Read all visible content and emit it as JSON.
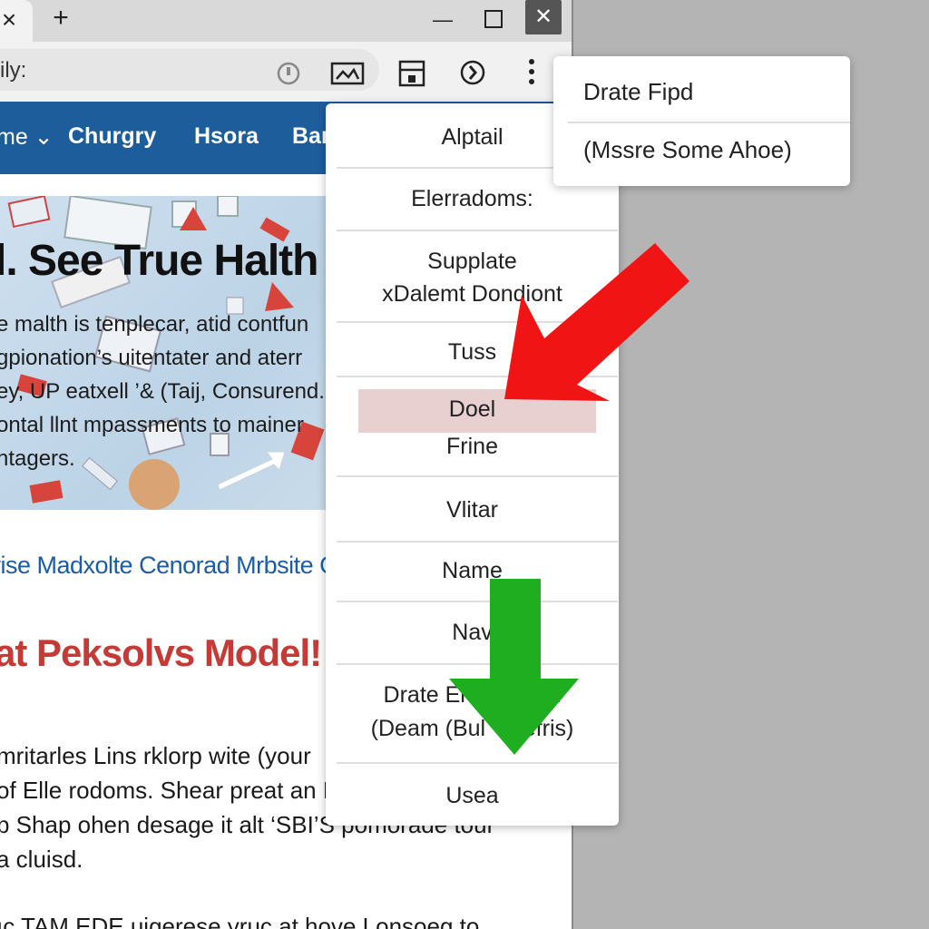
{
  "window": {
    "tab_close_glyph": "×",
    "new_tab_glyph": "+",
    "minimize_glyph": "—",
    "close_glyph": "✕"
  },
  "toolbar": {
    "address_text": "ily:",
    "icons": [
      "record-icon",
      "pip-icon",
      "save-page-icon",
      "extension-icon",
      "kebab-menu-icon"
    ]
  },
  "nav": {
    "items": [
      {
        "label": "me ⌄"
      },
      {
        "label": "Churgry"
      },
      {
        "label": "Hsora"
      },
      {
        "label": "Bar"
      }
    ]
  },
  "page": {
    "hero_title": "l. See True Halth a",
    "hero_lines": [
      "e malth is tenplecar, atid contfun",
      "gpionation’s uitentater and aterr",
      "ey, UP eatxell ’& (Taij, Consurend.",
      "ontal llnt mpassments to mainer",
      "ntagers."
    ],
    "blue_link": "rise Madxolte Cenorad Mrbsite Copp",
    "red_heading": "at Peksolvs Model!",
    "body_lines": [
      "mritarles Lins rklorp wite (your",
      "of Elle rodoms. Shear preat an E",
      "p Shap ohen desage it alt ‘SBI’S pomorade tour",
      "a cluisd.",
      "ıc TAM EDE uigerese yruc at hove Lonsoeg to"
    ]
  },
  "context_menu": {
    "items": [
      {
        "label": "Alptail"
      },
      {
        "label": "Elerradoms:"
      },
      {
        "label": "Supplate"
      },
      {
        "label": "xDalemt Dondiont"
      },
      {
        "label": "Tuss"
      },
      {
        "label": "Doel"
      },
      {
        "label": "Frine"
      },
      {
        "label": "Vlitar"
      },
      {
        "label": "Name"
      },
      {
        "label": "Nav"
      },
      {
        "label": "Drate Ente       dd"
      },
      {
        "label": "(Deam (Bul      efris)"
      },
      {
        "label": "Usea"
      }
    ],
    "highlight_color": "#e8cfd0"
  },
  "submenu": {
    "items": [
      {
        "label": "Drate Fipd"
      },
      {
        "label": "(Mssre Some Ahoe)"
      }
    ]
  },
  "annotations": {
    "red_arrow_color": "#f01414",
    "green_arrow_color": "#1fae1f"
  }
}
